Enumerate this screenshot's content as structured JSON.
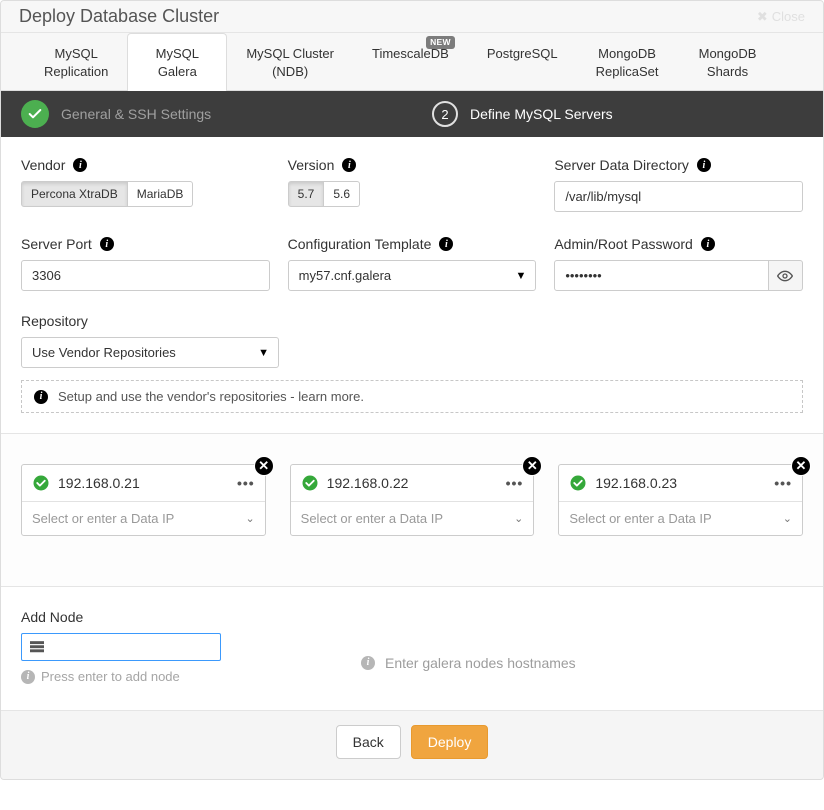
{
  "header": {
    "title": "Deploy Database Cluster",
    "close_label": "Close"
  },
  "tabs": [
    {
      "name": "mysql-replication",
      "label": "MySQL\nReplication",
      "active": false,
      "new": false
    },
    {
      "name": "mysql-galera",
      "label": "MySQL\nGalera",
      "active": true,
      "new": false
    },
    {
      "name": "mysql-cluster-ndb",
      "label": "MySQL Cluster\n(NDB)",
      "active": false,
      "new": false
    },
    {
      "name": "timescaledb",
      "label": "TimescaleDB",
      "active": false,
      "new": true,
      "new_label": "NEW"
    },
    {
      "name": "postgresql",
      "label": "PostgreSQL",
      "active": false,
      "new": false
    },
    {
      "name": "mongodb-replicaset",
      "label": "MongoDB\nReplicaSet",
      "active": false,
      "new": false
    },
    {
      "name": "mongodb-shards",
      "label": "MongoDB\nShards",
      "active": false,
      "new": false
    }
  ],
  "steps": {
    "step1": {
      "label": "General & SSH Settings",
      "done": true
    },
    "step2": {
      "num": "2",
      "label": "Define MySQL Servers",
      "current": true
    }
  },
  "form": {
    "vendor": {
      "label": "Vendor",
      "options": [
        {
          "label": "Percona XtraDB",
          "selected": true
        },
        {
          "label": "MariaDB",
          "selected": false
        }
      ]
    },
    "version": {
      "label": "Version",
      "options": [
        {
          "label": "5.7",
          "selected": true
        },
        {
          "label": "5.6",
          "selected": false
        }
      ]
    },
    "data_dir": {
      "label": "Server Data Directory",
      "value": "/var/lib/mysql"
    },
    "server_port": {
      "label": "Server Port",
      "value": "3306"
    },
    "config_template": {
      "label": "Configuration Template",
      "value": "my57.cnf.galera"
    },
    "password": {
      "label": "Admin/Root Password",
      "value": "••••••••"
    },
    "repository": {
      "label": "Repository",
      "value": "Use Vendor Repositories",
      "hint": "Setup and use the vendor's repositories - learn more."
    },
    "nodes": [
      {
        "ip": "192.168.0.21",
        "data_ip_placeholder": "Select or enter a Data IP"
      },
      {
        "ip": "192.168.0.22",
        "data_ip_placeholder": "Select or enter a Data IP"
      },
      {
        "ip": "192.168.0.23",
        "data_ip_placeholder": "Select or enter a Data IP"
      }
    ],
    "add_node": {
      "label": "Add Node",
      "below_hint": "Press enter to add node",
      "right_hint": "Enter galera nodes hostnames"
    }
  },
  "footer": {
    "back": "Back",
    "deploy": "Deploy"
  }
}
